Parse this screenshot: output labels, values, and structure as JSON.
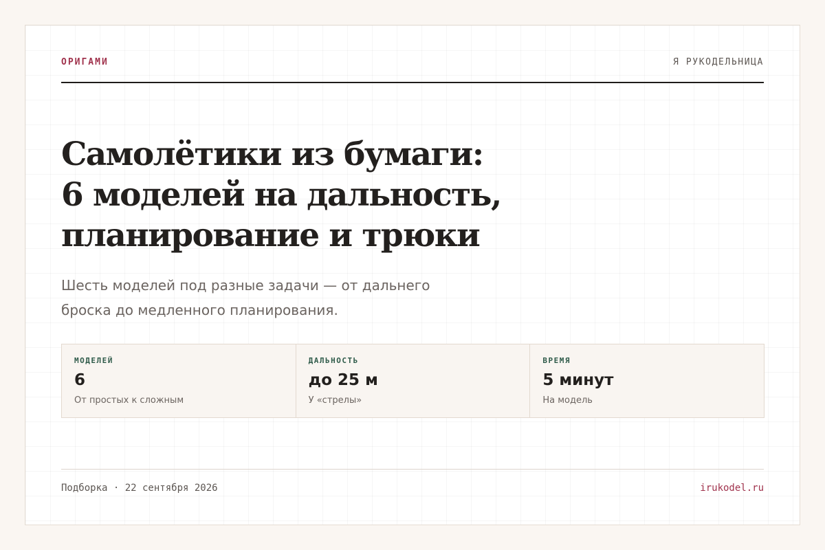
{
  "header": {
    "kicker": "ОРИГАМИ",
    "brand": "Я РУКОДЕЛЬНИЦА"
  },
  "article": {
    "title_lines": [
      "Самолётики из бумаги:",
      "6 моделей на дальность,",
      "планирование и трюки"
    ],
    "subtitle": "Шесть моделей под разные задачи — от дальнего броска до медленного планирования."
  },
  "stats": [
    {
      "label": "МОДЕЛЕЙ",
      "value": "6",
      "note": "От простых к сложным"
    },
    {
      "label": "ДАЛЬНОСТЬ",
      "value": "до 25 м",
      "note": "У «стрелы»"
    },
    {
      "label": "ВРЕМЯ",
      "value": "5 минут",
      "note": "На модель"
    }
  ],
  "footer": {
    "meta": "Подборка · 22 сентября 2026",
    "site": "irukodel.ru"
  },
  "colors": {
    "accent": "#a0324c",
    "label_green": "#2f5b4a",
    "ink": "#23201e",
    "muted": "#6b6460",
    "page_bg": "#faf6f2"
  }
}
